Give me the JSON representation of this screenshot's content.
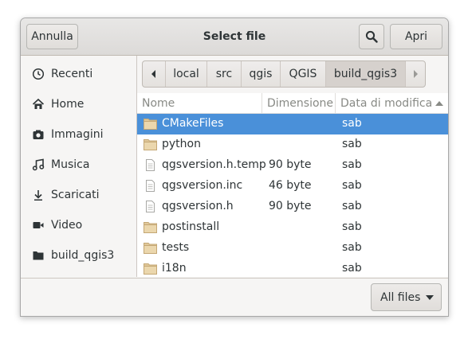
{
  "header": {
    "cancel_label": "Annulla",
    "title": "Select file",
    "open_label": "Apri",
    "search_icon": "search-icon"
  },
  "sidebar": {
    "items": [
      {
        "label": "Recenti",
        "icon": "clock-icon"
      },
      {
        "label": "Home",
        "icon": "home-icon"
      },
      {
        "label": "Immagini",
        "icon": "camera-icon"
      },
      {
        "label": "Musica",
        "icon": "music-icon"
      },
      {
        "label": "Scaricati",
        "icon": "download-icon"
      },
      {
        "label": "Video",
        "icon": "video-icon"
      },
      {
        "label": "build_qgis3",
        "icon": "folder-icon"
      }
    ]
  },
  "pathbar": {
    "segments": [
      "local",
      "src",
      "qgis",
      "QGIS",
      "build_qgis3"
    ],
    "active": "build_qgis3"
  },
  "columns": {
    "name": "Nome",
    "size": "Dimensione",
    "modified": "Data di modifica"
  },
  "files": [
    {
      "name": "CMakeFiles",
      "size": "",
      "modified": "sab",
      "type": "folder",
      "selected": true
    },
    {
      "name": "python",
      "size": "",
      "modified": "sab",
      "type": "folder"
    },
    {
      "name": "qgsversion.h.temp",
      "size": "90 byte",
      "modified": "sab",
      "type": "file"
    },
    {
      "name": "qgsversion.inc",
      "size": "46 byte",
      "modified": "sab",
      "type": "file"
    },
    {
      "name": "qgsversion.h",
      "size": "90 byte",
      "modified": "sab",
      "type": "file"
    },
    {
      "name": "postinstall",
      "size": "",
      "modified": "sab",
      "type": "folder"
    },
    {
      "name": "tests",
      "size": "",
      "modified": "sab",
      "type": "folder"
    },
    {
      "name": "i18n",
      "size": "",
      "modified": "sab",
      "type": "folder"
    }
  ],
  "filter": {
    "selected": "All files"
  },
  "colors": {
    "selection": "#4a90d9",
    "folder": "#e0c89a"
  }
}
